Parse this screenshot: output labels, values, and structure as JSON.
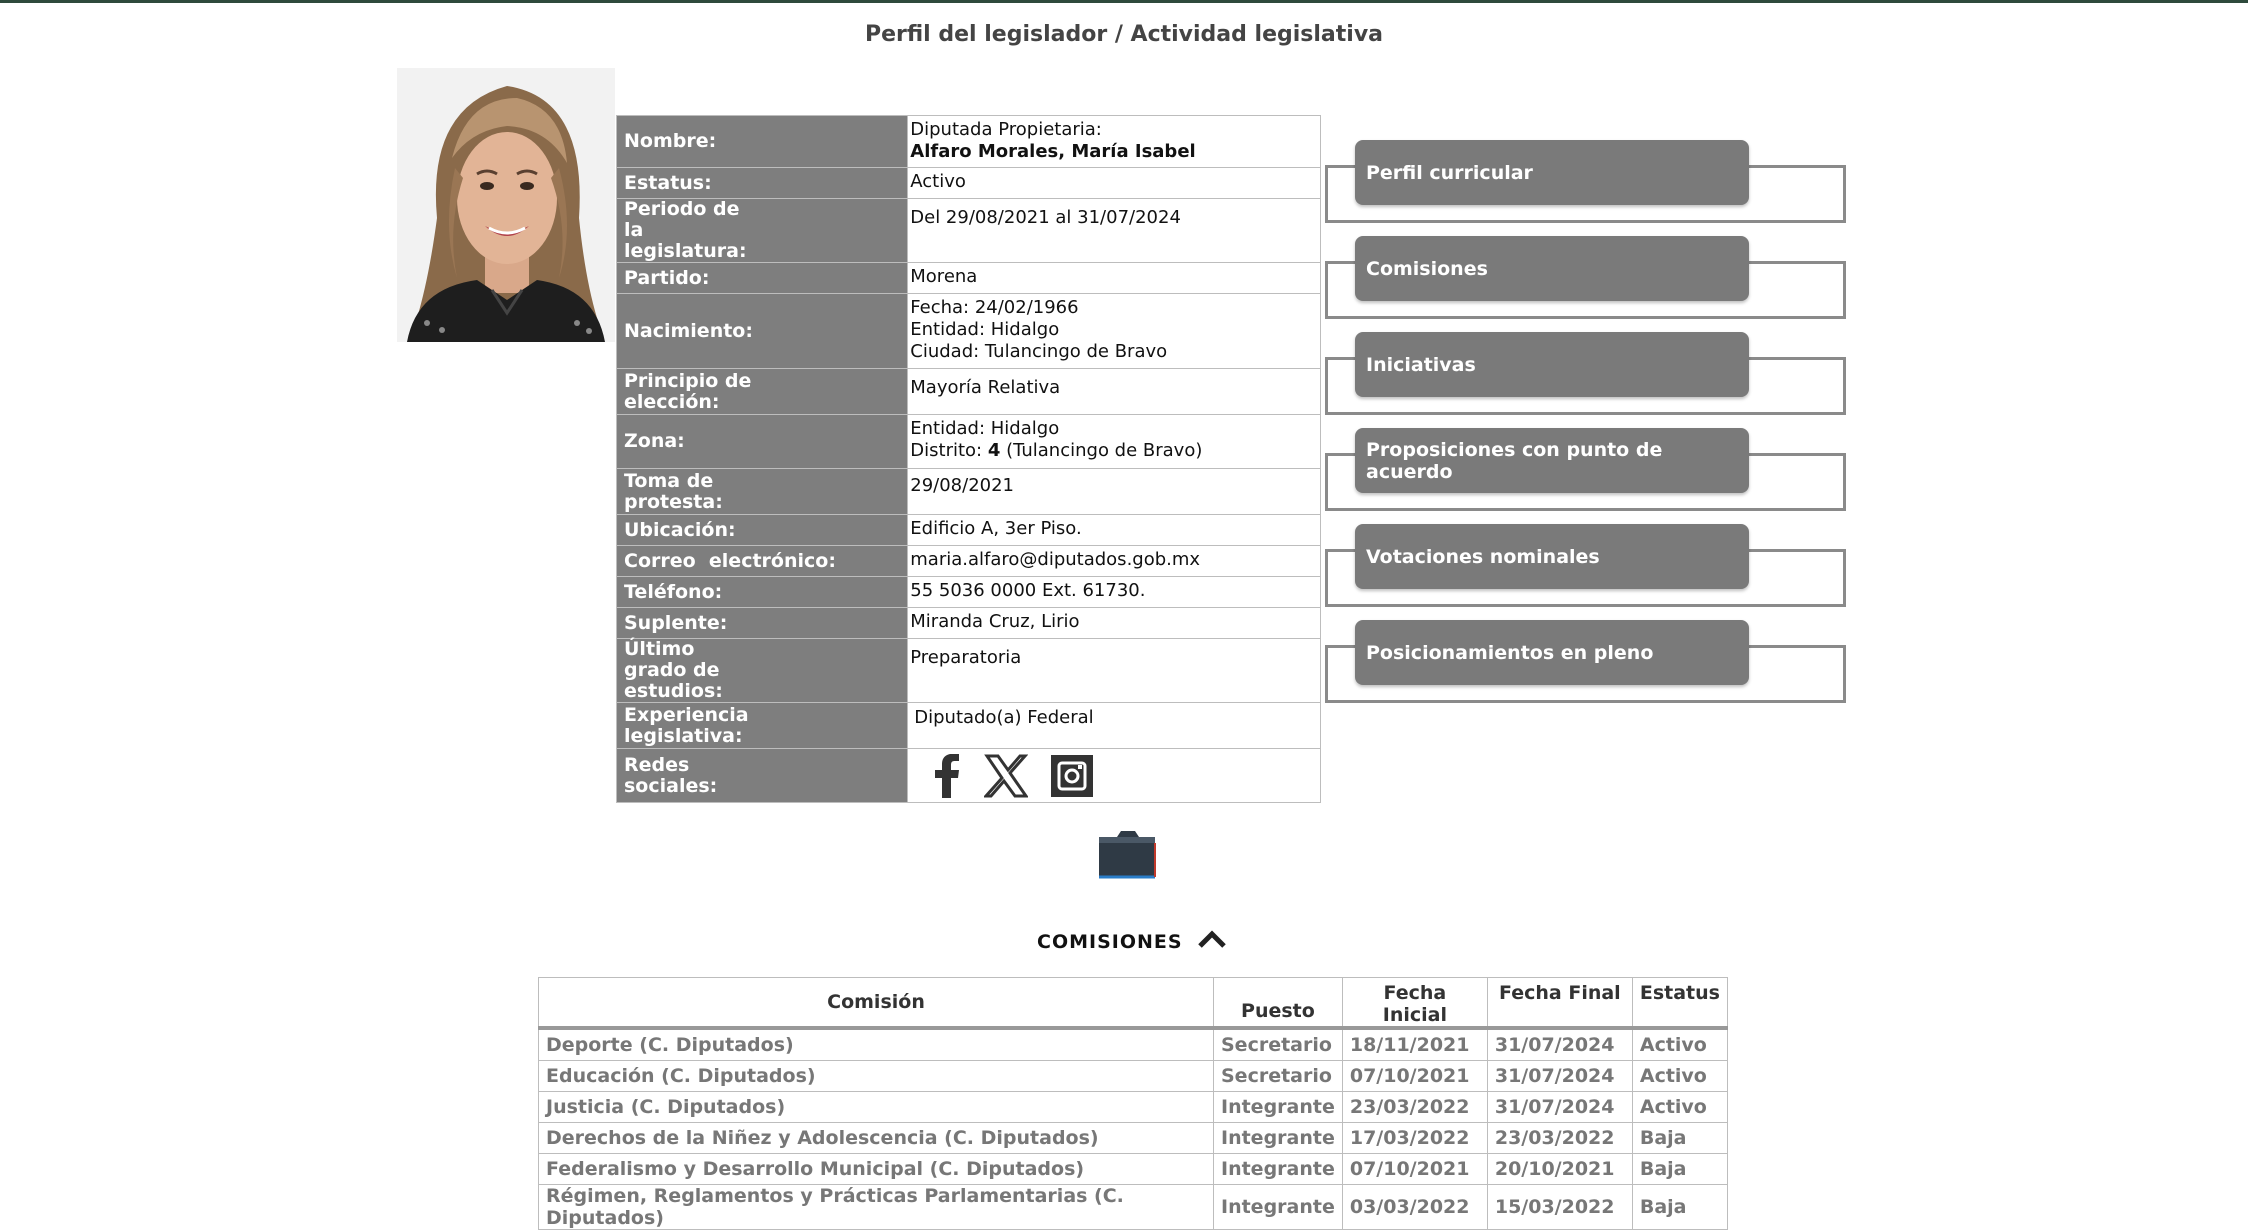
{
  "page_title": "Perfil del legislador / Actividad legislativa",
  "colors": {
    "label_bg": "#7e7e7e",
    "button_bg": "#7a7a7a",
    "topbar": "#2e4a3c"
  },
  "profile": {
    "rows": [
      {
        "label": "Nombre:",
        "lines": [
          "Diputada Propietaria:"
        ],
        "bold_line": "Alfaro Morales, María Isabel"
      },
      {
        "label": "Estatus:",
        "lines": [
          "Activo"
        ]
      },
      {
        "label": "Periodo de la legislatura:",
        "lines": [
          "Del 29/08/2021 al 31/07/2024"
        ]
      },
      {
        "label": "Partido:",
        "lines": [
          "Morena"
        ]
      },
      {
        "label": "Nacimiento:",
        "lines": [
          "Fecha: 24/02/1966",
          "Entidad: Hidalgo",
          "Ciudad: Tulancingo de Bravo"
        ]
      },
      {
        "label": "Principio de elección:",
        "lines": [
          "Mayoría Relativa"
        ]
      },
      {
        "label": "Zona:",
        "lines": [
          "Entidad: Hidalgo"
        ],
        "district_prefix": "Distrito: ",
        "district_num": "4",
        "district_suffix": " (Tulancingo de Bravo)"
      },
      {
        "label": "Toma de protesta:",
        "lines": [
          "29/08/2021"
        ]
      },
      {
        "label": "Ubicación:",
        "lines": [
          "Edificio A, 3er Piso."
        ]
      },
      {
        "label": "Correo  electrónico:",
        "lines": [
          "maria.alfaro@diputados.gob.mx"
        ]
      },
      {
        "label": "Teléfono:",
        "lines": [
          "55 5036 0000 Ext. 61730."
        ]
      },
      {
        "label": "Suplente:",
        "lines": [
          "Miranda Cruz, Lirio"
        ]
      },
      {
        "label": "Último grado de estudios:",
        "lines": [
          "Preparatoria"
        ]
      },
      {
        "label": "Experiencia legislativa:",
        "lines": [
          "Diputado(a) Federal"
        ]
      },
      {
        "label": "Redes sociales:",
        "icons": [
          "facebook-icon",
          "x-icon",
          "instagram-icon"
        ]
      }
    ]
  },
  "sections": [
    "Perfil curricular",
    "Comisiones",
    "Iniciativas",
    "Proposiciones con punto de acuerdo",
    "Votaciones nominales",
    "Posicionamientos en pleno"
  ],
  "commissions": {
    "heading": "COMISIONES",
    "columns": [
      "Comisión",
      "Puesto",
      "Fecha Inicial",
      "Fecha Final",
      "Estatus"
    ],
    "rows": [
      [
        "Deporte (C. Diputados)",
        "Secretario",
        "18/11/2021",
        "31/07/2024",
        "Activo"
      ],
      [
        "Educación (C. Diputados)",
        "Secretario",
        "07/10/2021",
        "31/07/2024",
        "Activo"
      ],
      [
        "Justicia (C. Diputados)",
        "Integrante",
        "23/03/2022",
        "31/07/2024",
        "Activo"
      ],
      [
        "Derechos de la Niñez y Adolescencia (C. Diputados)",
        "Integrante",
        "17/03/2022",
        "23/03/2022",
        "Baja"
      ],
      [
        "Federalismo y Desarrollo Municipal (C. Diputados)",
        "Integrante",
        "07/10/2021",
        "20/10/2021",
        "Baja"
      ],
      [
        "Régimen, Reglamentos y Prácticas Parlamentarias (C. Diputados)",
        "Integrante",
        "03/03/2022",
        "15/03/2022",
        "Baja"
      ]
    ]
  }
}
